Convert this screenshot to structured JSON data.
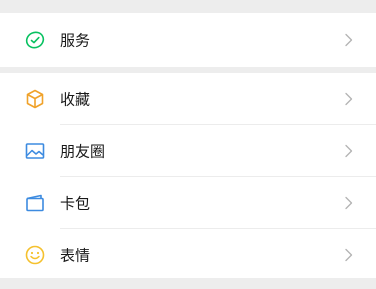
{
  "menu": {
    "services": {
      "label": "服务",
      "icon": "service-icon",
      "color": "#07c160"
    },
    "favorites": {
      "label": "收藏",
      "icon": "favorites-cube-icon",
      "color": "#f0a22a"
    },
    "moments": {
      "label": "朋友圈",
      "icon": "moments-image-icon",
      "color": "#3d8be0"
    },
    "cards": {
      "label": "卡包",
      "icon": "card-wallet-icon",
      "color": "#3d8be0"
    },
    "stickers": {
      "label": "表情",
      "icon": "sticker-smile-icon",
      "color": "#f5c12e"
    }
  },
  "colors": {
    "background": "#ededed",
    "row": "#ffffff",
    "text": "#191919",
    "chevron": "#b2b2b2"
  }
}
